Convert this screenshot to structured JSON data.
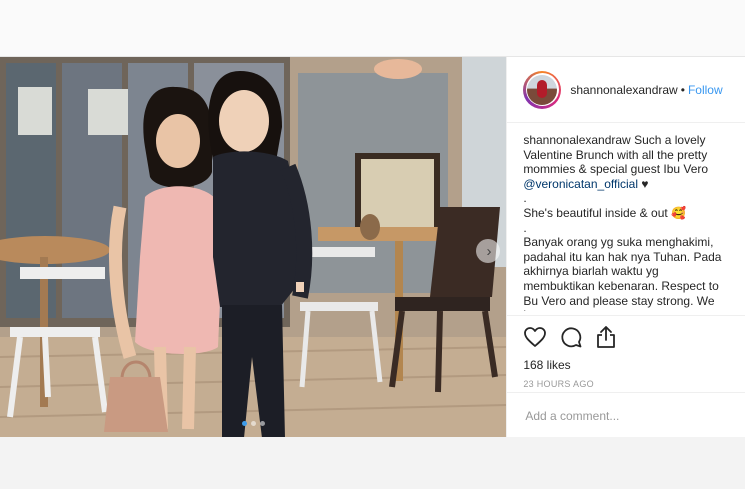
{
  "post": {
    "username": "shannonalexandraw",
    "separator": "•",
    "follow_label": "Follow",
    "caption": {
      "line1_user": "shannonalexandraw",
      "line1_text": " Such a lovely Valentine Brunch with all the pretty mommies & special guest Ibu Vero ",
      "mention": "@veronicatan_official",
      "heart": " ♥",
      "dot1": ".",
      "line2": "She's beautiful inside & out 🥰",
      "dot2": ".",
      "line3": "Banyak orang yg suka menghakimi, padahal itu kan hak nya Tuhan. Pada akhirnya biarlah waktu yg membuktikan kebenaran. Respect to Bu Vero and please stay strong. We love you"
    },
    "likes": "168 likes",
    "timestamp": "23 HOURS AGO",
    "comment_placeholder": "Add a comment...",
    "carousel": {
      "next_icon": "chevron-right-icon",
      "dots": 3,
      "active_index": 0
    }
  },
  "icons": {
    "like": "heart-outline-icon",
    "comment": "speech-bubble-icon",
    "share": "share-upload-icon"
  },
  "colors": {
    "follow": "#3897f0",
    "mention": "#00376b",
    "text": "#262626",
    "muted": "#999999",
    "active_dot": "#3d9be9"
  }
}
